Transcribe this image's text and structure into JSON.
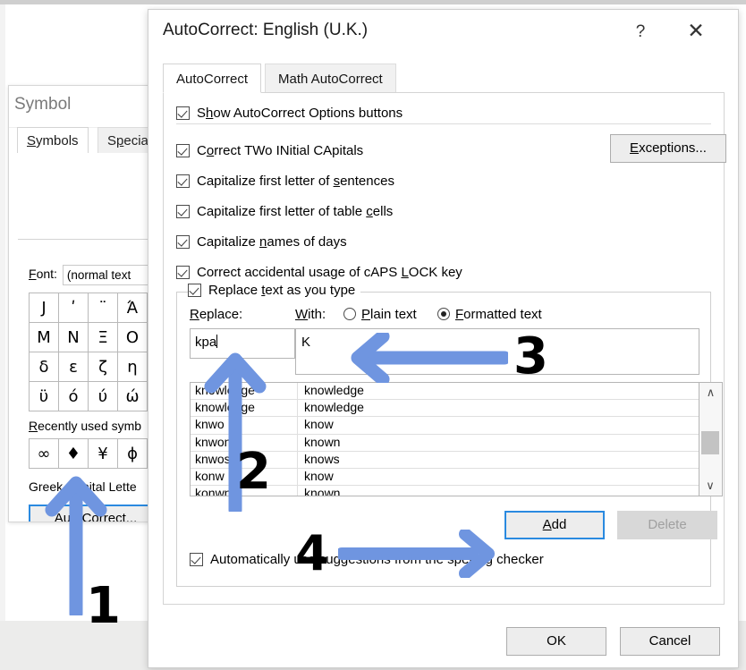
{
  "symbol_dialog": {
    "title": "Symbol",
    "tabs": [
      {
        "label": "Symbols",
        "active": true
      },
      {
        "label": "Special",
        "active": false
      }
    ],
    "font_label": "Font:",
    "font_value": "(normal text",
    "symbol_grid": [
      [
        "J",
        "ʹ",
        "¨",
        "Ά"
      ],
      [
        "M",
        "N",
        "Ξ",
        "O"
      ],
      [
        "δ",
        "ε",
        "ζ",
        "η"
      ],
      [
        "ϋ",
        "ό",
        "ύ",
        "ώ"
      ]
    ],
    "recent_label": "Recently used symb",
    "recent_symbols": [
      "∞",
      "♦",
      "¥",
      "ϕ"
    ],
    "char_name": "Greek Capital Lette",
    "autocorrect_button": "AutoCorrect..."
  },
  "autocorrect_dialog": {
    "title": "AutoCorrect: English (U.K.)",
    "help_icon": "?",
    "close_icon": "✕",
    "tabs": [
      {
        "label": "AutoCorrect",
        "active": true
      },
      {
        "label": "Math AutoCorrect",
        "active": false
      }
    ],
    "options": [
      {
        "label_pre": "S",
        "label_key": "h",
        "label_post": "ow AutoCorrect Options buttons",
        "checked": true
      },
      {
        "label_pre": "C",
        "label_key": "o",
        "label_post": "rrect TWo INitial CApitals",
        "checked": true
      },
      {
        "label_pre": "Capitalize first letter of ",
        "label_key": "s",
        "label_post": "entences",
        "checked": true
      },
      {
        "label_pre": "Capitalize first letter of table ",
        "label_key": "c",
        "label_post": "ells",
        "checked": true
      },
      {
        "label_pre": "Capitalize ",
        "label_key": "n",
        "label_post": "ames of days",
        "checked": true
      },
      {
        "label_pre": "Correct accidental usage of cAPS ",
        "label_key": "L",
        "label_post": "OCK key",
        "checked": true
      }
    ],
    "exceptions_button": {
      "pre": "",
      "key": "E",
      "post": "xceptions..."
    },
    "replace_group": {
      "checkbox": {
        "pre": "Replace ",
        "key": "t",
        "post": "ext as you type",
        "checked": true
      },
      "replace_label": {
        "key": "R",
        "post": "eplace:"
      },
      "with_label": {
        "key": "W",
        "post": "ith:"
      },
      "radio_plain": {
        "key": "P",
        "post": "lain text",
        "selected": false
      },
      "radio_formatted": {
        "key": "F",
        "post": "ormatted text",
        "selected": true
      },
      "replace_value": "kpa",
      "with_value": "K",
      "entries": [
        {
          "from": "knowledge",
          "to": "knowledge"
        },
        {
          "from": "knowledge",
          "to": "knowledge"
        },
        {
          "from": "knwo",
          "to": "know"
        },
        {
          "from": "knwon",
          "to": "known"
        },
        {
          "from": "knwos",
          "to": "knows"
        },
        {
          "from": "konw",
          "to": "know"
        },
        {
          "from": "konwn",
          "to": "known"
        }
      ],
      "scroll_up_icon": "∧",
      "scroll_down_icon": "∨",
      "add_button": {
        "key": "A",
        "post": "dd"
      },
      "delete_button": "Delete",
      "auto_suggestions": {
        "pre": "Automatically use suggestions from the spelling checker",
        "checked": true
      }
    },
    "ok_button": "OK",
    "cancel_button": "Cancel"
  },
  "annotations": {
    "arrow_color": "#6f95e0",
    "steps": [
      {
        "number": "1",
        "target": "autocorrect-button",
        "direction": "up"
      },
      {
        "number": "2",
        "target": "replace-input",
        "direction": "up"
      },
      {
        "number": "3",
        "target": "with-input",
        "direction": "left"
      },
      {
        "number": "4",
        "target": "add-button",
        "direction": "right"
      }
    ]
  }
}
